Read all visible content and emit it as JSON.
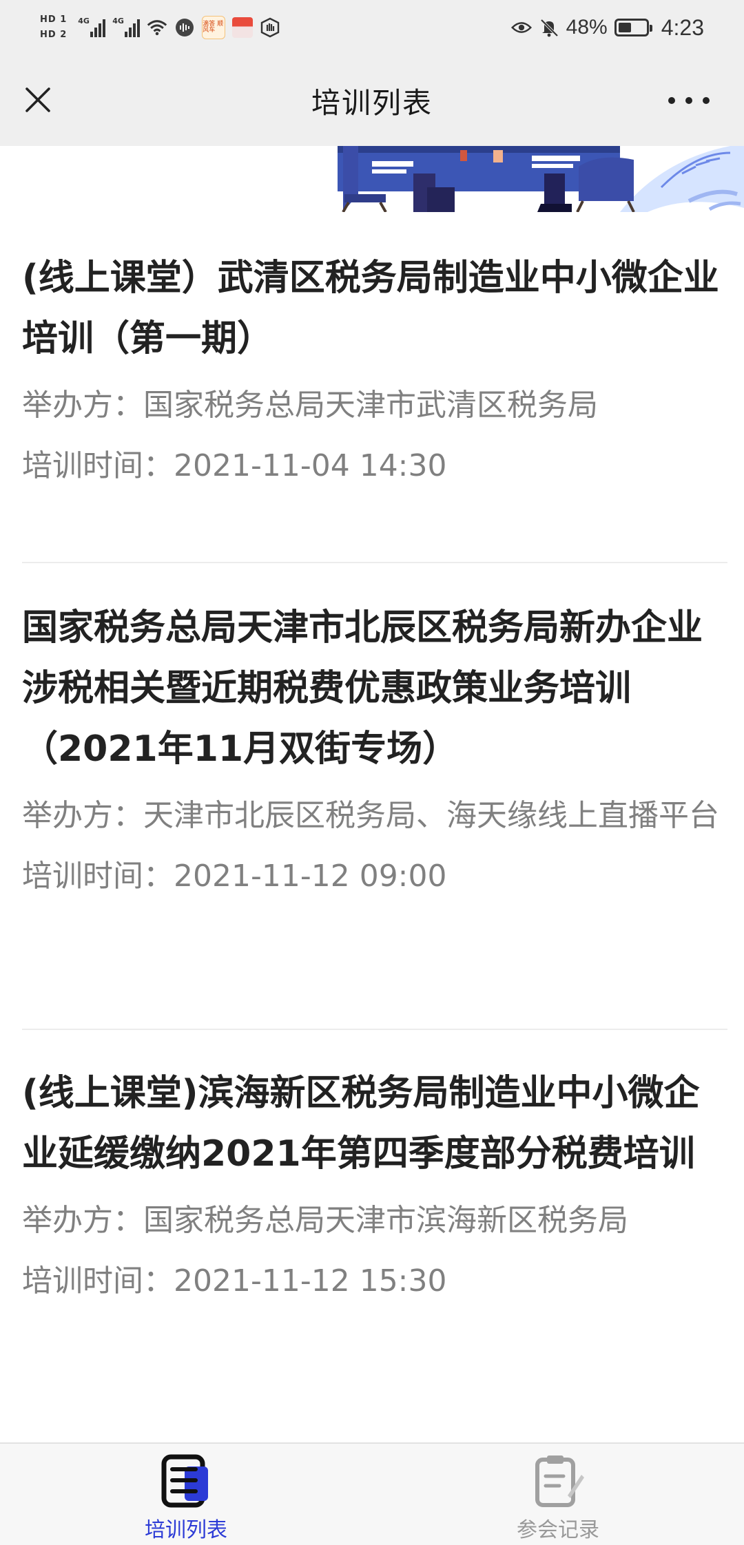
{
  "status_bar": {
    "sim1": "HD 1",
    "sim2": "HD 2",
    "net1": "4G",
    "net2": "4G",
    "battery_text": "48%",
    "battery_level": 0.48,
    "time": "4:23",
    "app_badge_text": "滴答 顺风车"
  },
  "nav": {
    "title": "培训列表"
  },
  "trainings": [
    {
      "title": "(线上课堂）武清区税务局制造业中小微企业培训（第一期）",
      "organizer_label": "举办方：",
      "organizer": "国家税务总局天津市武清区税务局",
      "time_label": "培训时间：",
      "time": "2021-11-04 14:30"
    },
    {
      "title": "国家税务总局天津市北辰区税务局新办企业涉税相关暨近期税费优惠政策业务培训（2021年11月双街专场）",
      "organizer_label": "举办方：",
      "organizer": "天津市北辰区税务局、海天缘线上直播平台",
      "time_label": "培训时间：",
      "time": "2021-11-12 09:00"
    },
    {
      "title": "(线上课堂)滨海新区税务局制造业中小微企业延缓缴纳2021年第四季度部分税费培训",
      "organizer_label": "举办方：",
      "organizer": "国家税务总局天津市滨海新区税务局",
      "time_label": "培训时间：",
      "time": "2021-11-12 15:30"
    }
  ],
  "tabs": [
    {
      "label": "培训列表",
      "icon": "list-doc-icon",
      "active": true
    },
    {
      "label": "参会记录",
      "icon": "record-clipboard-icon",
      "active": false
    }
  ],
  "colors": {
    "accent": "#2c3bd6",
    "title_text": "#222222",
    "meta_text": "#808080",
    "nav_bg": "#efefef"
  }
}
